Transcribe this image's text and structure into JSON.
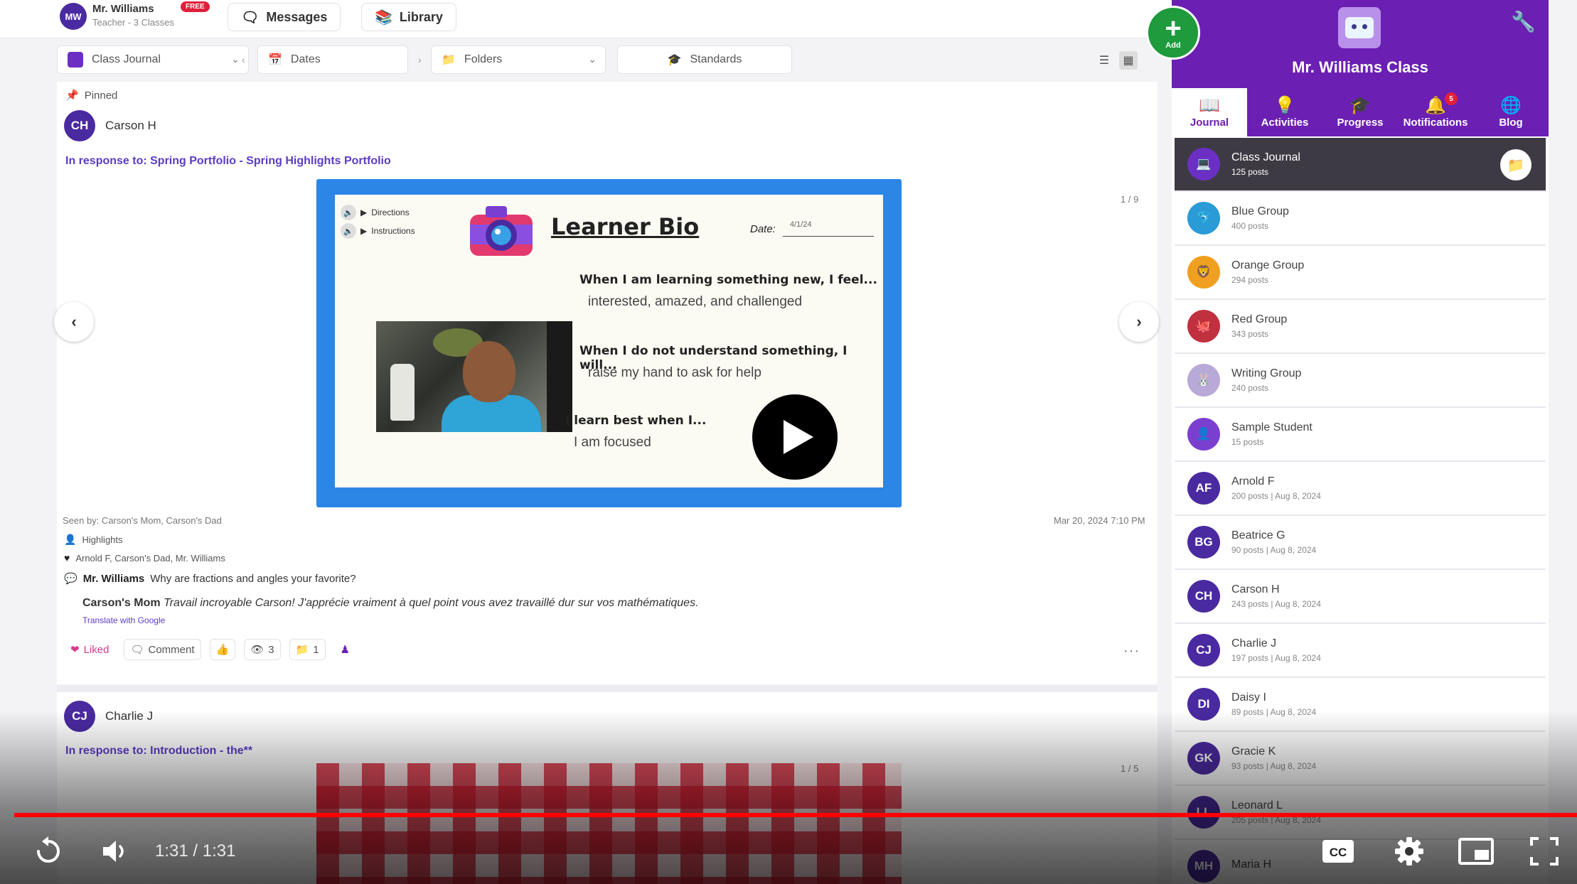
{
  "top": {
    "user_name": "Mr. Williams",
    "user_role": "Teacher - 3 Classes",
    "user_initials": "MW",
    "badge": "FREE",
    "messages_label": "Messages",
    "library_label": "Library"
  },
  "filters": {
    "journal": "Class Journal",
    "dates": "Dates",
    "folders": "Folders",
    "standards": "Standards"
  },
  "post1": {
    "pinned_label": "Pinned",
    "author": "Carson H",
    "author_initials": "CH",
    "response": "In response to: Spring Portfolio - Spring Highlights Portfolio",
    "page_counter": "1 / 9",
    "slide": {
      "audio1": "Directions",
      "audio2": "Instructions",
      "title": "Learner Bio",
      "date_label": "Date:",
      "date_value": "4/1/24",
      "q1": "When I am learning something new, I feel...",
      "a1": "interested, amazed, and challenged",
      "q2": "When I do not understand something, I will...",
      "a2": "raise my hand to ask for help",
      "q3": "I learn best when I...",
      "a3": "I am focused"
    },
    "seen_by": "Seen by: Carson's Mom, Carson's Dad",
    "timestamp": "Mar 20, 2024 7:10 PM",
    "skill": "Highlights",
    "liked_by": "Arnold F, Carson's Dad, Mr. Williams",
    "comment1_author": "Mr. Williams",
    "comment1_text": "Why are fractions and angles your favorite?",
    "comment2_author": "Carson's Mom",
    "comment2_text": "Travail incroyable Carson! J'apprécie vraiment à quel point vous avez travaillé dur sur vos mathématiques.",
    "translate": "Translate with Google",
    "actions": {
      "liked": "Liked",
      "comment": "Comment",
      "views": "3",
      "folders": "1"
    }
  },
  "post2": {
    "author": "Charlie J",
    "author_initials": "CJ",
    "response": "In response to: Introduction - the**",
    "page_counter": "1 / 5"
  },
  "sidebar": {
    "add_label": "Add",
    "class_title": "Mr. Williams Class",
    "tabs": [
      {
        "label": "Journal",
        "icon": "book-icon"
      },
      {
        "label": "Activities",
        "icon": "lightbulb-icon"
      },
      {
        "label": "Progress",
        "icon": "graduation-cap-icon"
      },
      {
        "label": "Notifications",
        "icon": "bell-icon",
        "badge": "5"
      },
      {
        "label": "Blog",
        "icon": "globe-icon"
      }
    ],
    "items": [
      {
        "name": "Class Journal",
        "sub": "125 posts",
        "initials": "",
        "color": "#6b2fc4"
      },
      {
        "name": "Blue Group",
        "sub": "400 posts",
        "initials": "",
        "color": "#2a9bd6"
      },
      {
        "name": "Orange Group",
        "sub": "294 posts",
        "initials": "",
        "color": "#f0a020"
      },
      {
        "name": "Red Group",
        "sub": "343 posts",
        "initials": "",
        "color": "#c0303e"
      },
      {
        "name": "Writing Group",
        "sub": "240 posts",
        "initials": "",
        "color": "#b8a9d8"
      },
      {
        "name": "Sample Student",
        "sub": "15 posts",
        "initials": "",
        "color": "#7b3fd0"
      },
      {
        "name": "Arnold F",
        "sub": "200 posts | Aug 8, 2024",
        "initials": "AF",
        "color": "#4a2aa0"
      },
      {
        "name": "Beatrice G",
        "sub": "90 posts | Aug 8, 2024",
        "initials": "BG",
        "color": "#4a2aa0"
      },
      {
        "name": "Carson H",
        "sub": "243 posts | Aug 8, 2024",
        "initials": "CH",
        "color": "#4a2aa0"
      },
      {
        "name": "Charlie J",
        "sub": "197 posts | Aug 8, 2024",
        "initials": "CJ",
        "color": "#4a2aa0"
      },
      {
        "name": "Daisy I",
        "sub": "89 posts | Aug 8, 2024",
        "initials": "DI",
        "color": "#4a2aa0"
      },
      {
        "name": "Gracie K",
        "sub": "93 posts | Aug 8, 2024",
        "initials": "GK",
        "color": "#4a2aa0"
      },
      {
        "name": "Leonard L",
        "sub": "205 posts | Aug 8, 2024",
        "initials": "LL",
        "color": "#4a2aa0"
      },
      {
        "name": "Maria H",
        "sub": "",
        "initials": "MH",
        "color": "#4a2aa0"
      }
    ]
  },
  "player": {
    "time": "1:31 / 1:31",
    "progress_percent": 100,
    "accent_color": "#ff0000"
  }
}
